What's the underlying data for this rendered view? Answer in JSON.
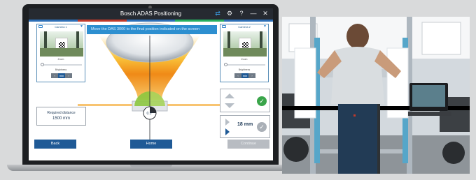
{
  "window": {
    "title": "Bosch ADAS Positioning"
  },
  "titlebar": {
    "icons": [
      "network-icon",
      "gear-icon",
      "help-icon",
      "minimize-icon",
      "close-icon"
    ],
    "glyphs": [
      "⇄",
      "⚙",
      "?",
      "—",
      "✕"
    ]
  },
  "accent_colors": [
    "#2d6fb7",
    "#c0392b",
    "#2d6fb7",
    "#27ae60",
    "#2d6fb7"
  ],
  "banner": {
    "text": "Move the DAS 3000 to the final position indicated on the screen"
  },
  "camera_left": {
    "title": "Camera 1",
    "zoom_label": "Zoom",
    "brightness_label": "Brightness",
    "stepper_value": "min"
  },
  "camera_right": {
    "title": "Camera 2",
    "zoom_label": "Zoom",
    "brightness_label": "Brightness",
    "stepper_value": "min"
  },
  "gauge": {
    "angle": "0.5°"
  },
  "distance": {
    "label": "Required distance",
    "value": "1500  mm"
  },
  "offset": {
    "value": "18  mm"
  },
  "buttons": {
    "back": "Back",
    "home": "Home",
    "continue": "Continue"
  },
  "colors": {
    "primary_button": "#1f5a96",
    "disabled_button": "#b8bcc2",
    "check_ok": "#3aa54a",
    "check_pending": "#aab0b7",
    "banner": "#2d8fd0"
  }
}
